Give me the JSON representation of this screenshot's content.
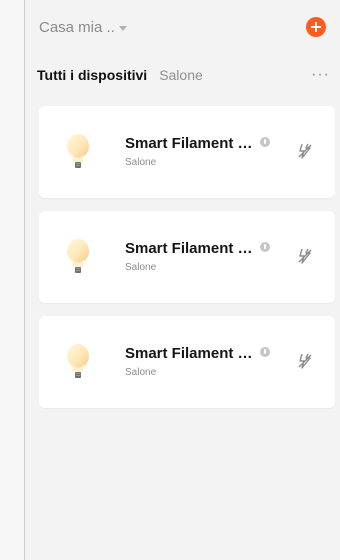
{
  "header": {
    "home_name": "Casa mia ..",
    "add_icon": "plus-circle-icon",
    "accent": "#ff5a1f"
  },
  "tabs": [
    {
      "label": "Tutti i dispositivi",
      "active": true
    },
    {
      "label": "Salone",
      "active": false
    }
  ],
  "more_icon": "more-horizontal-icon",
  "devices": [
    {
      "name": "Smart Filament WI...",
      "room": "Salone",
      "icon": "bulb-icon",
      "status_icon": "offline-icon"
    },
    {
      "name": "Smart Filament WI...",
      "room": "Salone",
      "icon": "bulb-icon",
      "status_icon": "offline-icon"
    },
    {
      "name": "Smart Filament WI...",
      "room": "Salone",
      "icon": "bulb-icon",
      "status_icon": "offline-icon"
    }
  ]
}
